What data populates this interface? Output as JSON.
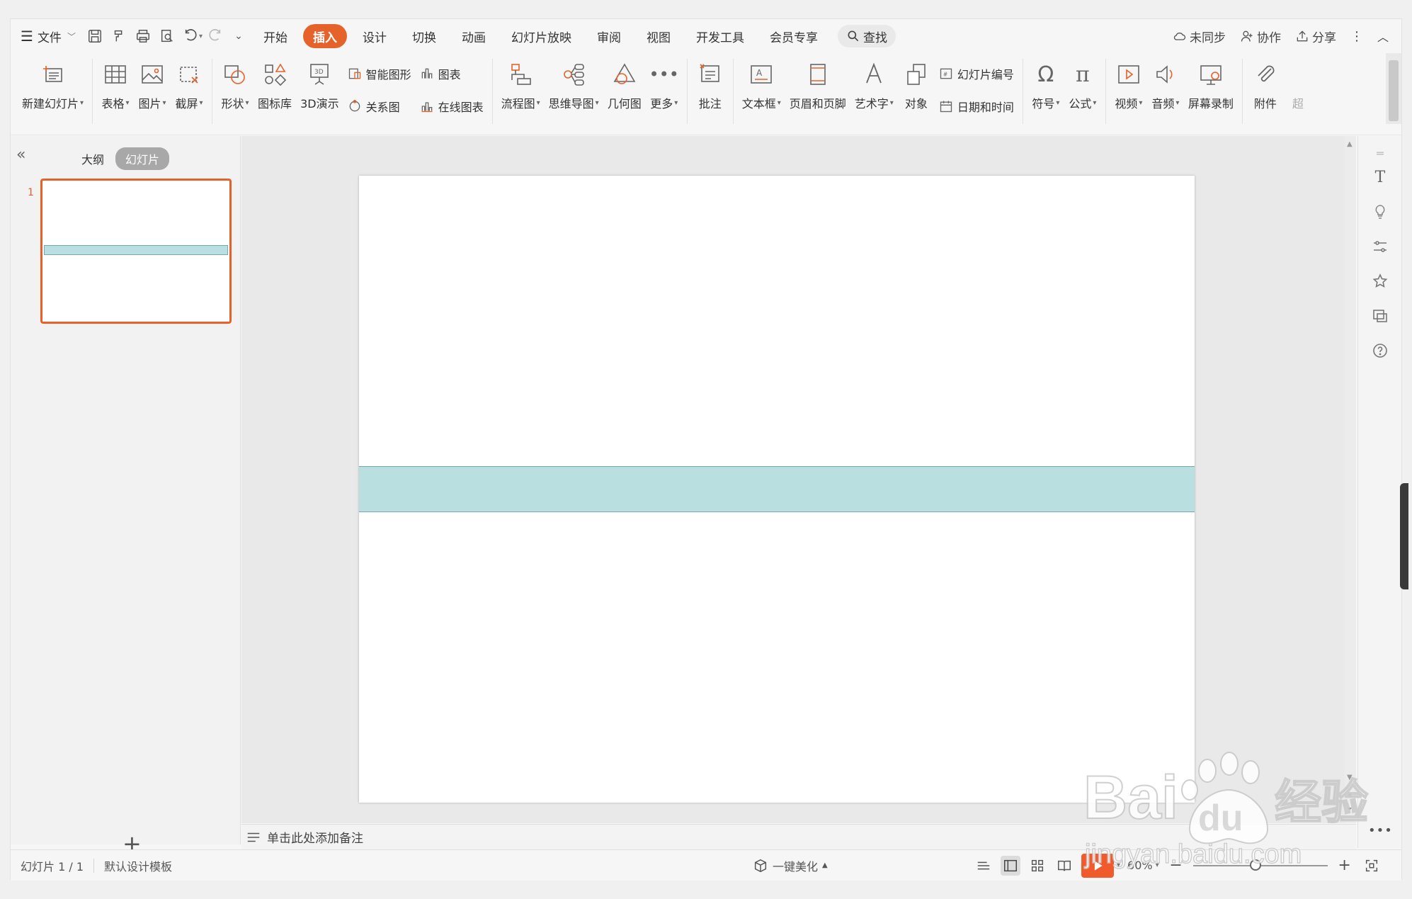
{
  "menubar": {
    "file_label": "文件",
    "tabs": [
      "开始",
      "插入",
      "设计",
      "切换",
      "动画",
      "幻灯片放映",
      "审阅",
      "视图",
      "开发工具",
      "会员专享"
    ],
    "active_tab": "插入",
    "search_label": "查找",
    "right": {
      "sync": "未同步",
      "collab": "协作",
      "share": "分享"
    }
  },
  "ribbon": {
    "new_slide": "新建幻灯片",
    "table": "表格",
    "picture": "图片",
    "screenshot": "截屏",
    "shape": "形状",
    "icon_lib": "图标库",
    "demo3d": "3D演示",
    "smart_art": "智能图形",
    "chart": "图表",
    "relation": "关系图",
    "online_chart": "在线图表",
    "flowchart": "流程图",
    "mindmap": "思维导图",
    "geometry": "几何图",
    "more": "更多",
    "comment": "批注",
    "textbox": "文本框",
    "header_footer": "页眉和页脚",
    "wordart": "艺术字",
    "object": "对象",
    "slide_number": "幻灯片编号",
    "datetime": "日期和时间",
    "symbol": "符号",
    "formula": "公式",
    "video": "视频",
    "audio": "音频",
    "screen_record": "屏幕录制",
    "attachment": "附件",
    "overflow": "超"
  },
  "leftpanel": {
    "tab_outline": "大纲",
    "tab_slides": "幻灯片",
    "slide_number": "1"
  },
  "notes": {
    "placeholder": "单击此处添加备注"
  },
  "statusbar": {
    "page": "幻灯片 1 / 1",
    "template": "默认设计模板",
    "beautify": "一键美化",
    "zoom": "60%"
  },
  "colors": {
    "accent": "#e5632a",
    "band_fill": "#b9dfe1",
    "band_stroke": "#7aa7ad"
  },
  "watermark": {
    "brand": "Bai",
    "paw_text": "du",
    "site_cn": "经验",
    "url": "jingyan.baidu.com"
  }
}
